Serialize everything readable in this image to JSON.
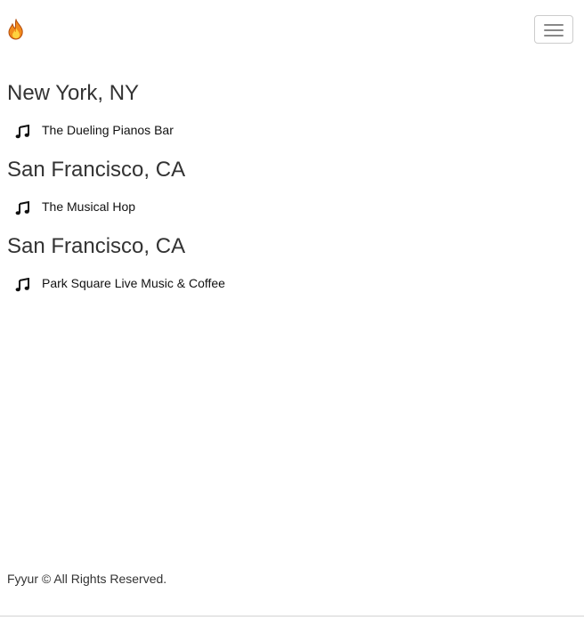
{
  "navbar": {
    "brand_icon": "flame-icon",
    "menu_icon": "hamburger-menu-icon"
  },
  "cities": [
    {
      "name": "New York, NY",
      "venues": [
        {
          "name": "The Dueling Pianos Bar",
          "icon": "music-note-icon"
        }
      ]
    },
    {
      "name": "San Francisco, CA",
      "venues": [
        {
          "name": "The Musical Hop",
          "icon": "music-note-icon"
        }
      ]
    },
    {
      "name": "San Francisco, CA",
      "venues": [
        {
          "name": "Park Square Live Music & Coffee",
          "icon": "music-note-icon"
        }
      ]
    }
  ],
  "footer": {
    "text": "Fyyur © All Rights Reserved."
  },
  "colors": {
    "flame_outer": "#f28a1c",
    "flame_inner": "#ffd23f",
    "text": "#333333"
  }
}
